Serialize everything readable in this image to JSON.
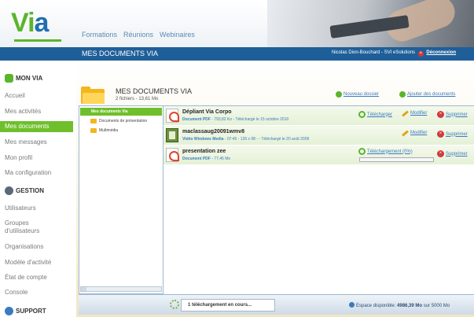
{
  "app": {
    "logo_text_1": "Vi",
    "logo_text_2": "a"
  },
  "topnav": [
    "Formations",
    "Réunions",
    "Webinaires"
  ],
  "titlebar": {
    "title": "MES DOCUMENTS VIA",
    "user": "Nicolas Dion-Bouchard - SVI eSolutions",
    "logout": "Déconnexion"
  },
  "sidebar": {
    "sections": [
      {
        "title": "MON VIA",
        "icon": "user-icon",
        "color": "#5ab52c"
      },
      {
        "title": "GESTION",
        "icon": "gear-icon",
        "color": "#5a6878"
      },
      {
        "title": "SUPPORT",
        "icon": "question-icon",
        "color": "#3a7bbf"
      }
    ],
    "items": [
      "Accueil",
      "Mes activités",
      "Mes documents",
      "Mes messages",
      "Mon profil",
      "Ma configuration",
      "Utilisateurs",
      "Groupes",
      "d'utilisateurs",
      "Organisations",
      "Modèle d'activité",
      "État de compte",
      "Console"
    ],
    "active_index": 2
  },
  "panel": {
    "title": "MES DOCUMENTS VIA",
    "subtitle": "2 fichiers - 13,61 Mo",
    "new_folder": "Nouveau dossier",
    "add_documents": "Ajouter des documents"
  },
  "tree": {
    "root": "Mes documents Via",
    "folders": [
      "Documents de présentation",
      "Multimédia"
    ]
  },
  "files": [
    {
      "name": "Dépliant Via Corpo",
      "type": "Document PDF",
      "details": "793,82 Ko - Téléchargé le 15 octobre 2010",
      "download": "Télécharger",
      "edit": "Modifier",
      "delete": "Supprimer"
    },
    {
      "name": "maclassaug20091wmv8",
      "type": "Vidéo Windows Media",
      "details": "07:45 - 126 x 98 - - Téléchargé le 20 août 2009",
      "edit": "Modifier",
      "delete": "Supprimer"
    },
    {
      "name": "presentation zee",
      "type": "Document PDF",
      "details": "77,46 Mo",
      "progress_label": "Téléchargement (0%)",
      "progress": 0.0,
      "delete": "Supprimer"
    }
  ],
  "status": {
    "downloads": "1 téléchargement en cours...",
    "space_label": "Espace disponible:",
    "space_value": "4986,39 Mo",
    "space_total": "sur 5000 Mo"
  },
  "colors": {
    "accent_green": "#6fbf2c",
    "brand_blue": "#1f5f99",
    "link_blue": "#3a7bbf"
  }
}
